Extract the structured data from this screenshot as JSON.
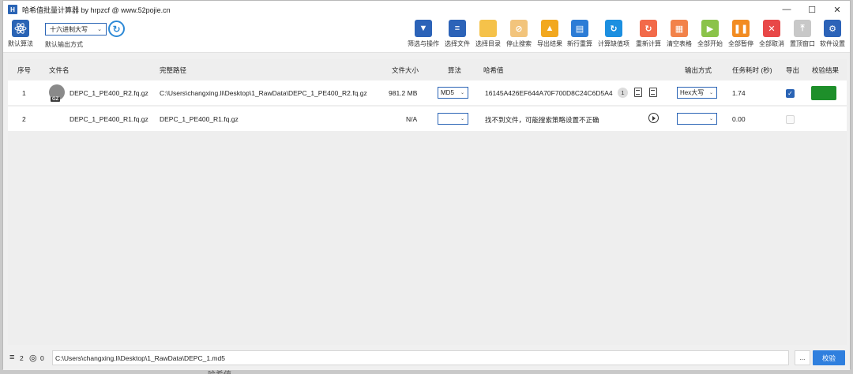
{
  "window": {
    "app_icon": "H",
    "title": "哈希值批量计算器 by hrpzcf @ www.52pojie.cn",
    "buttons": [
      "—",
      "☐",
      "✕"
    ]
  },
  "left_tools": {
    "default_algo": {
      "icon": "atom-icon",
      "label": "默认算法",
      "color": "#2a64b5"
    },
    "output_select": {
      "value": "十六进制大写",
      "arrow": "⌄"
    },
    "refresh_icon": "↻",
    "default_output_label": "默认输出方式"
  },
  "toolbar": [
    {
      "name": "filter",
      "label": "筛选与操作",
      "glyph": "▼",
      "color": "#2c63b8"
    },
    {
      "name": "choose-file",
      "label": "选择文件",
      "glyph": "≡",
      "color": "#2c63b8"
    },
    {
      "name": "choose-dir",
      "label": "选择目录",
      "glyph": "",
      "color": "#f5c24a"
    },
    {
      "name": "stop-search",
      "label": "停止搜索",
      "glyph": "⊘",
      "color": "#f2c47c"
    },
    {
      "name": "export-result",
      "label": "导出结果",
      "glyph": "▲",
      "color": "#f2a81f"
    },
    {
      "name": "newline-recalc",
      "label": "新行重算",
      "glyph": "▤",
      "color": "#2c7cd6"
    },
    {
      "name": "calc-missing",
      "label": "计算缺值项",
      "glyph": "↻",
      "color": "#1c8fe0"
    },
    {
      "name": "recalc",
      "label": "重新计算",
      "glyph": "↻",
      "color": "#f26a4a"
    },
    {
      "name": "clear-table",
      "label": "清空表格",
      "glyph": "▦",
      "color": "#f2824a"
    },
    {
      "name": "start-all",
      "label": "全部开始",
      "glyph": "▶",
      "color": "#8bc34a"
    },
    {
      "name": "pause-all",
      "label": "全部暂停",
      "glyph": "❚❚",
      "color": "#f28c22"
    },
    {
      "name": "cancel-all",
      "label": "全部取消",
      "glyph": "✕",
      "color": "#e84848"
    },
    {
      "name": "pin-top",
      "label": "置顶窗口",
      "glyph": "⤒",
      "color": "#c8c8c8"
    },
    {
      "name": "settings",
      "label": "软件设置",
      "glyph": "⚙",
      "color": "#2c63b8"
    }
  ],
  "table": {
    "headers": {
      "index": "序号",
      "filename": "文件名",
      "path": "完整路径",
      "size": "文件大小",
      "algo": "算法",
      "hash": "哈希值",
      "output": "输出方式",
      "time": "任务耗时 (秒)",
      "export": "导出",
      "verify": "校验结果"
    },
    "rows": [
      {
        "index": "1",
        "filename": "DEPC_1_PE400_R2.fq.gz",
        "file_badge": "GZ",
        "path": "C:\\Users\\changxing.li\\Desktop\\1_RawData\\DEPC_1_PE400_R2.fq.gz",
        "size": "981.2 MB",
        "algo": "MD5",
        "hash": "16145A426EF644A70F700D8C24C6D5A4",
        "hash_count": "1",
        "output": "Hex大写",
        "time": "1.74",
        "export_checked": true,
        "check_mark": "✓",
        "verify_color": "#1e8f2a"
      },
      {
        "index": "2",
        "filename": "DEPC_1_PE400_R1.fq.gz",
        "path": "DEPC_1_PE400_R1.fq.gz",
        "size": "N/A",
        "algo": "",
        "hash": "找不到文件，可能搜索策略设置不正确",
        "output": "",
        "time": "0.00",
        "export_checked": false
      }
    ]
  },
  "statusbar": {
    "list_icon": "≡",
    "list_count": "2",
    "ring_icon": "◎",
    "ring_count": "0",
    "path": "C:\\Users\\changxing.li\\Desktop\\1_RawData\\DEPC_1.md5",
    "browse_label": "...",
    "verify_label": "校验"
  },
  "background_peek": "哈希值"
}
